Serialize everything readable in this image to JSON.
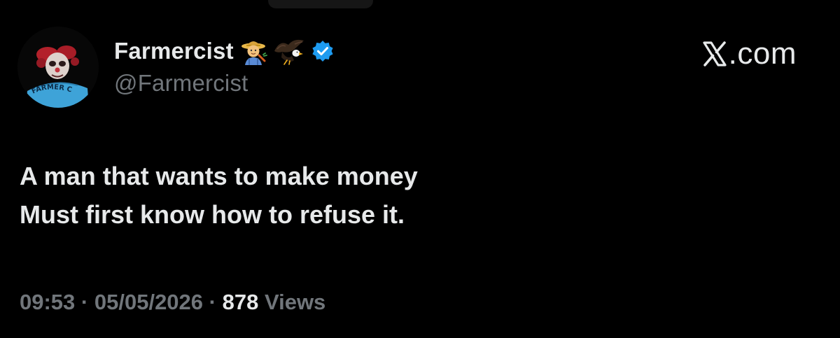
{
  "author": {
    "display_name": "Farmercist",
    "handle": "@Farmercist",
    "emojis": [
      "farmer-emoji",
      "eagle-emoji"
    ],
    "verified": true,
    "verified_color": "#1d9bf0"
  },
  "avatar": {
    "caption": "FARMER CIST"
  },
  "brand": {
    "suffix": ".com"
  },
  "tweet": {
    "lines": [
      "A man that wants to make money",
      "Must first know how to refuse it."
    ]
  },
  "meta": {
    "time": "09:53",
    "separator": "·",
    "date": "05/05/2026",
    "views_count": "878",
    "views_label": "Views"
  },
  "colors": {
    "background": "#000000",
    "primary_text": "#e7e9ea",
    "secondary_text": "#71767b",
    "accent": "#1d9bf0"
  }
}
